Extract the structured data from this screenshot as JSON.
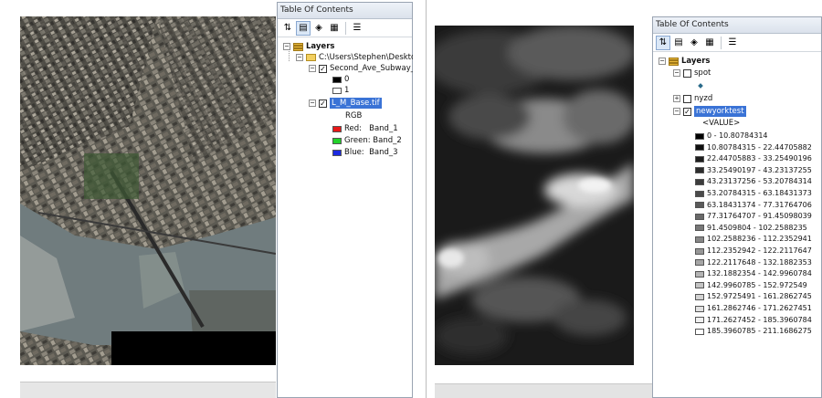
{
  "left_toc": {
    "title": "Table Of Contents",
    "layers_label": "Layers",
    "folder_path": "C:\\Users\\Stephen\\Desktop",
    "subway_layer": "Second_Ave_Subway_",
    "subway_legend": [
      "0",
      "1"
    ],
    "base_layer": "L_M_Base.tif",
    "rgb_label": "RGB",
    "bands": [
      {
        "label": "Red:   Band_1",
        "color": "#e81818"
      },
      {
        "label": "Green: Band_2",
        "color": "#22d22a"
      },
      {
        "label": "Blue:  Band_3",
        "color": "#1c2ae0"
      }
    ]
  },
  "right_toc": {
    "title": "Table Of Contents",
    "layers_label": "Layers",
    "spot_layer": "spot",
    "nyzd_layer": "nyzd",
    "dem_layer": "newyorktest",
    "value_header": "<VALUE>",
    "classes": [
      "0 - 10.80784314",
      "10.80784315 - 22.44705882",
      "22.44705883 - 33.25490196",
      "33.25490197 - 43.23137255",
      "43.23137256 - 53.20784314",
      "53.20784315 - 63.18431373",
      "63.18431374 - 77.31764706",
      "77.31764707 - 91.45098039",
      "91.4509804 - 102.2588235",
      "102.2588236 - 112.2352941",
      "112.2352942 - 122.2117647",
      "122.2117648 - 132.1882353",
      "132.1882354 - 142.9960784",
      "142.9960785 - 152.972549",
      "152.9725491 - 161.2862745",
      "161.2862746 - 171.2627451",
      "171.2627452 - 185.3960784",
      "185.3960785 - 211.1686275"
    ],
    "class_colors": [
      "#000000",
      "#0f0f0f",
      "#1e1e1e",
      "#2d2d2d",
      "#3c3c3c",
      "#4b4b4b",
      "#5a5a5a",
      "#696969",
      "#787878",
      "#878787",
      "#969696",
      "#a5a5a5",
      "#b4b4b4",
      "#c3c3c3",
      "#d2d2d2",
      "#e1e1e1",
      "#f0f0f0",
      "#ffffff"
    ]
  }
}
